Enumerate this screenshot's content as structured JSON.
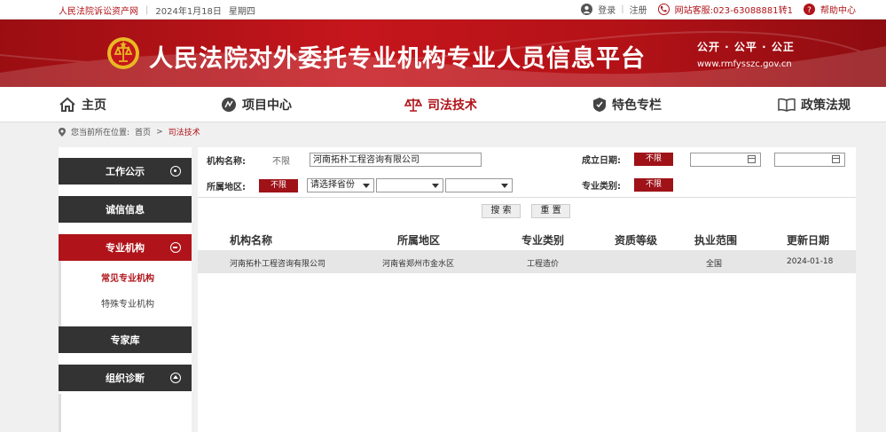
{
  "topbar": {
    "site_link": "人民法院诉讼资产网",
    "separator": "|",
    "date": "2024年1月18日",
    "weekday": "星期四",
    "login": "登录",
    "register": "注册",
    "hotline": "网站客服:023-63088881转1",
    "help": "帮助中心"
  },
  "banner": {
    "title": "人民法院对外委托专业机构专业人员信息平台",
    "motto": "公开 · 公平 · 公正",
    "domain": "www.rmfysszc.gov.cn"
  },
  "nav": [
    {
      "label": "主页",
      "icon": "home-icon"
    },
    {
      "label": "项目中心",
      "icon": "project-icon"
    },
    {
      "label": "司法技术",
      "icon": "scales-icon"
    },
    {
      "label": "特色专栏",
      "icon": "feature-icon"
    },
    {
      "label": "政策法规",
      "icon": "book-icon"
    }
  ],
  "breadcrumb": {
    "prefix": "您当前所在位置:",
    "home": "首页",
    "arrow": ">",
    "current": "司法技术"
  },
  "sidebar": {
    "sections": [
      {
        "label": "工作公示"
      },
      {
        "label": "诚信信息"
      },
      {
        "label": "专业机构"
      },
      {
        "label": "专家库"
      },
      {
        "label": "组织诊断"
      }
    ],
    "sub_items": [
      "常见专业机构",
      "特殊专业机构"
    ]
  },
  "filters": {
    "org_name_label": "机构名称:",
    "org_name_unlimited": "不限",
    "org_name_value": "河南拓朴工程咨询有限公司",
    "founded_label": "成立日期:",
    "founded_unlimited": "不限",
    "region_label": "所属地区:",
    "region_unlimited": "不限",
    "province_value": "请选择省份",
    "specialty_label": "专业类别:",
    "specialty_unlimited": "不限",
    "search_button": "搜 索",
    "reset_button": "重 置"
  },
  "table": {
    "headers": [
      "机构名称",
      "所属地区",
      "专业类别",
      "资质等级",
      "执业范围",
      "更新日期"
    ],
    "rows": [
      [
        "河南拓朴工程咨询有限公司",
        "河南省郑州市金水区",
        "工程造价",
        "",
        "全国",
        "2024-01-18"
      ]
    ]
  },
  "colors": {
    "brand_red": "#b0141a",
    "dark_side": "#333333"
  }
}
